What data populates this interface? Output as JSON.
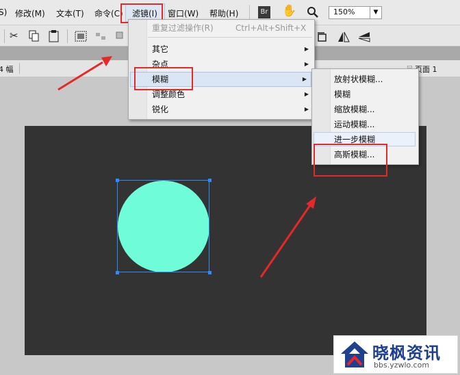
{
  "menubar": {
    "items": [
      "S)",
      "修改(M)",
      "文本(T)",
      "命令(C)",
      "滤镜(I)",
      "窗口(W)",
      "帮助(H)"
    ],
    "br_label": "Br",
    "zoom_value": "150%"
  },
  "tabbar": {
    "left_text": "4 幅",
    "right_text": "页面 1"
  },
  "filter_menu": {
    "repeat": "重复过滤操作(R)",
    "shortcut": "Ctrl+Alt+Shift+X",
    "items": [
      "其它",
      "杂点",
      "模糊",
      "调整颜色",
      "锐化"
    ]
  },
  "blur_submenu": {
    "items": [
      "放射状模糊...",
      "模糊",
      "缩放模糊...",
      "运动模糊...",
      "进一步模糊",
      "高斯模糊..."
    ]
  },
  "watermark": {
    "title": "晓枫资讯",
    "url": "bbs.yzwlo.com"
  },
  "colors": {
    "highlight_red": "#e52828",
    "shape_fill": "#6ffcd8",
    "stage_bg": "#333333",
    "selection": "#2e8bff"
  },
  "icons": [
    "scissors-icon",
    "copy-icon",
    "paste-icon",
    "hand-icon",
    "magnifier-icon"
  ]
}
